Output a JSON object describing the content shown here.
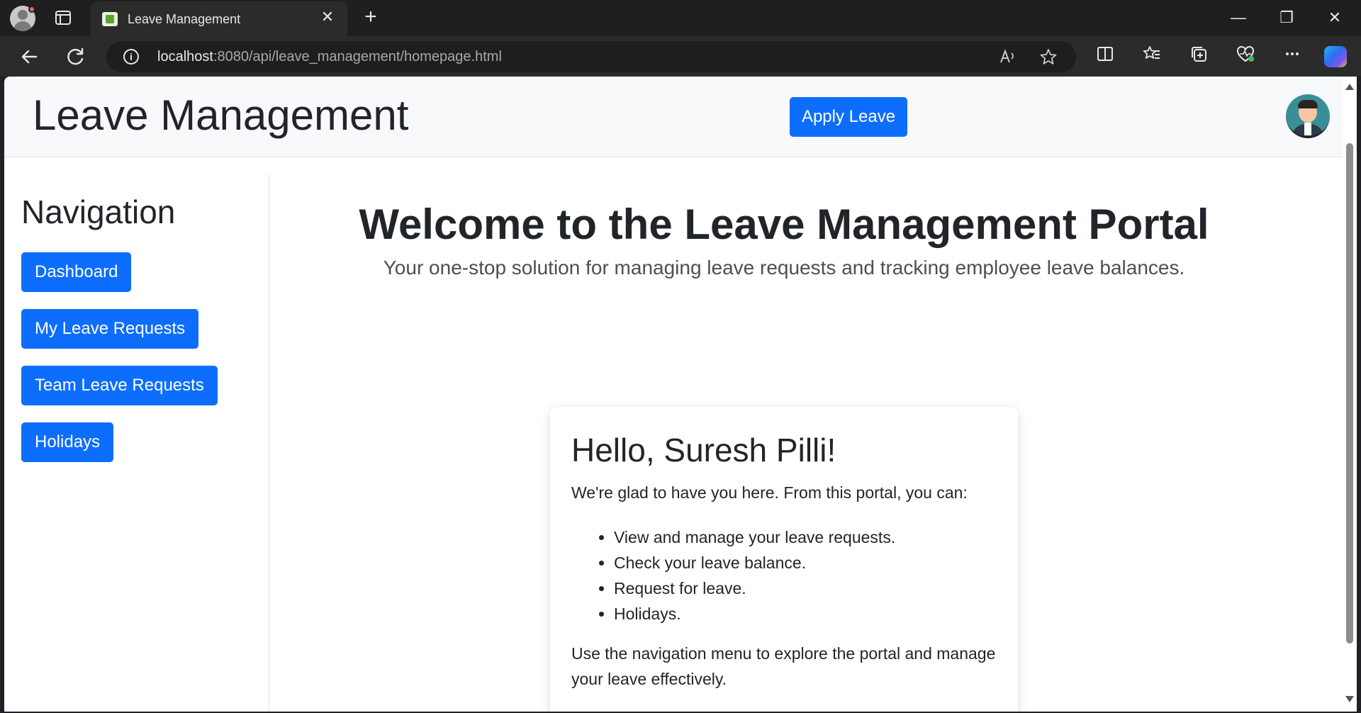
{
  "browser": {
    "tab_title": "Leave Management",
    "tab_close": "✕",
    "new_tab": "+",
    "url_host": "localhost",
    "url_path": ":8080/api/leave_management/homepage.html",
    "window_minimize": "—",
    "window_restore": "❐",
    "window_close": "✕"
  },
  "header": {
    "brand": "Leave Management",
    "apply_button": "Apply Leave"
  },
  "sidebar": {
    "title": "Navigation",
    "items": [
      {
        "label": "Dashboard"
      },
      {
        "label": "My Leave Requests"
      },
      {
        "label": "Team Leave Requests"
      },
      {
        "label": "Holidays"
      }
    ]
  },
  "main": {
    "title": "Welcome to the Leave Management Portal",
    "subtitle": "Your one-stop solution for managing leave requests and tracking employee leave balances.",
    "card": {
      "greeting": "Hello, Suresh Pilli!",
      "intro": "We're glad to have you here. From this portal, you can:",
      "features": [
        "View and manage your leave requests.",
        "Check your leave balance.",
        "Request for leave.",
        "Holidays."
      ],
      "outro": "Use the navigation menu to explore the portal and manage your leave effectively."
    }
  },
  "colors": {
    "primary": "#0d6efd",
    "header_bg": "#f8f9fa",
    "text": "#212529"
  }
}
